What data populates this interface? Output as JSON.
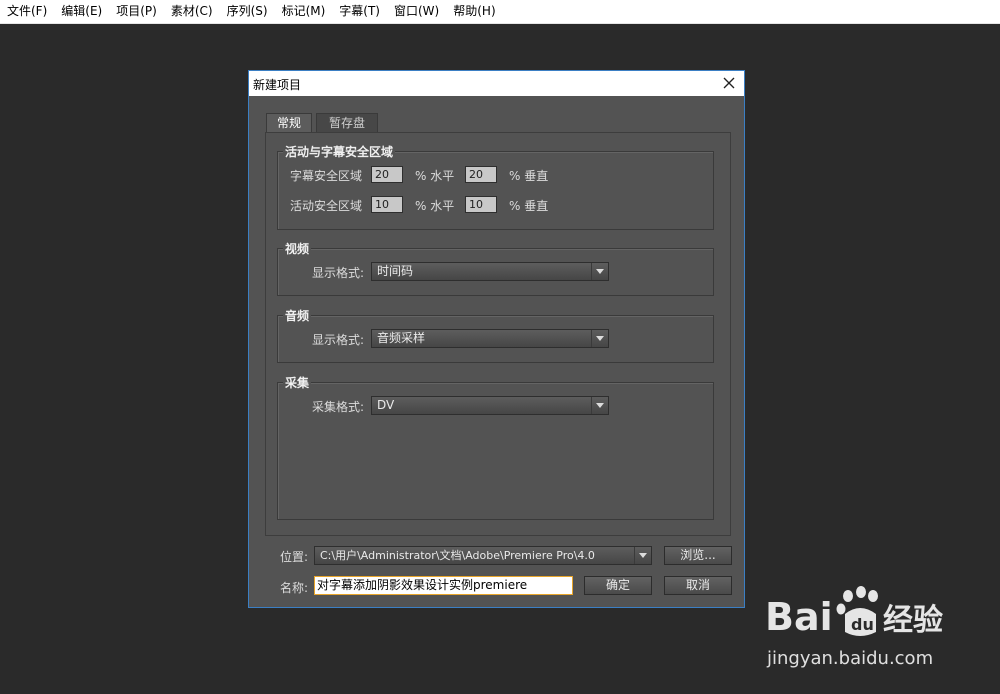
{
  "menubar": {
    "items": [
      "文件(F)",
      "编辑(E)",
      "项目(P)",
      "素材(C)",
      "序列(S)",
      "标记(M)",
      "字幕(T)",
      "窗口(W)",
      "帮助(H)"
    ]
  },
  "dialog": {
    "title": "新建项目",
    "tabs": [
      {
        "label": "常规",
        "active": true
      },
      {
        "label": "暂存盘",
        "active": false
      }
    ],
    "safe_area": {
      "group_label": "活动与字幕安全区域",
      "title_safe_label": "字幕安全区域",
      "title_safe_h": "20",
      "title_safe_v": "20",
      "action_safe_label": "活动安全区域",
      "action_safe_h": "10",
      "action_safe_v": "10",
      "unit_h": "% 水平",
      "unit_v": "% 垂直"
    },
    "video": {
      "group_label": "视频",
      "display_format_label": "显示格式:",
      "display_format_value": "时间码"
    },
    "audio": {
      "group_label": "音频",
      "display_format_label": "显示格式:",
      "display_format_value": "音频采样"
    },
    "capture": {
      "group_label": "采集",
      "capture_format_label": "采集格式:",
      "capture_format_value": "DV"
    },
    "location": {
      "label": "位置:",
      "value": "C:\\用户\\Administrator\\文档\\Adobe\\Premiere Pro\\4.0",
      "browse_label": "浏览..."
    },
    "name": {
      "label": "名称:",
      "value": "对字幕添加阴影效果设计实例premiere"
    },
    "ok_label": "确定",
    "cancel_label": "取消"
  },
  "watermark": {
    "logo_text": "Bai du 经验",
    "url": "jingyan.baidu.com"
  },
  "colors": {
    "desktop": "#2a2a2a",
    "dialog_bg": "#535353",
    "focus_border": "#e8a52a",
    "dialog_border": "#3b7fc4"
  }
}
